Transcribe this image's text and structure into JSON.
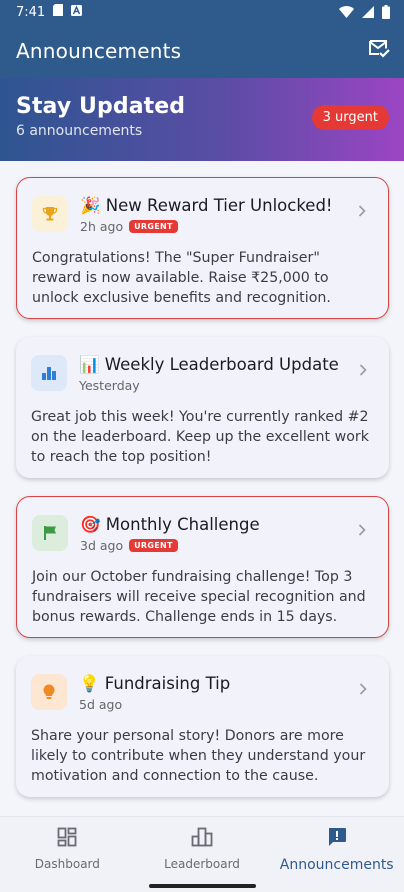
{
  "status_bar": {
    "time": "7:41"
  },
  "app_bar": {
    "title": "Announcements",
    "action_icon": "mark-read-icon"
  },
  "hero": {
    "title": "Stay Updated",
    "subtitle": "6 announcements",
    "urgent_label": "3 urgent"
  },
  "cards": [
    {
      "emoji": "🎉",
      "title": "New Reward Tier Unlocked!",
      "time": "2h ago",
      "badge": "URGENT",
      "body": "Congratulations! The \"Super Fundraiser\" reward is now available. Raise ₹25,000 to unlock exclusive benefits and recognition.",
      "icon": "trophy-icon"
    },
    {
      "emoji": "📊",
      "title": "Weekly Leaderboard Update",
      "time": "Yesterday",
      "body": "Great job this week! You're currently ranked #2 on the leaderboard. Keep up the excellent work to reach the top position!",
      "icon": "bar-chart-icon"
    },
    {
      "emoji": "🎯",
      "title": "Monthly Challenge",
      "time": "3d ago",
      "badge": "URGENT",
      "body": "Join our October fundraising challenge! Top 3 fundraisers will receive special recognition and bonus rewards. Challenge ends in 15 days.",
      "icon": "flag-icon"
    },
    {
      "emoji": "💡",
      "title": "Fundraising Tip",
      "time": "5d ago",
      "body": "Share your personal story! Donors are more likely to contribute when they understand your motivation and connection to the cause.",
      "icon": "lightbulb-icon"
    }
  ],
  "nav": [
    {
      "label": "Dashboard",
      "icon": "dashboard-icon"
    },
    {
      "label": "Leaderboard",
      "icon": "leaderboard-icon"
    },
    {
      "label": "Announcements",
      "icon": "announcement-icon",
      "active": true
    }
  ],
  "colors": {
    "primary": "#2f5a8c",
    "gradient_end": "#9b45c3",
    "urgent": "#e53935",
    "trophy_bg": "#fbf0d8",
    "chart_bg": "#dde8f8",
    "flag_bg": "#dcecdd",
    "bulb_bg": "#fde6d2"
  }
}
